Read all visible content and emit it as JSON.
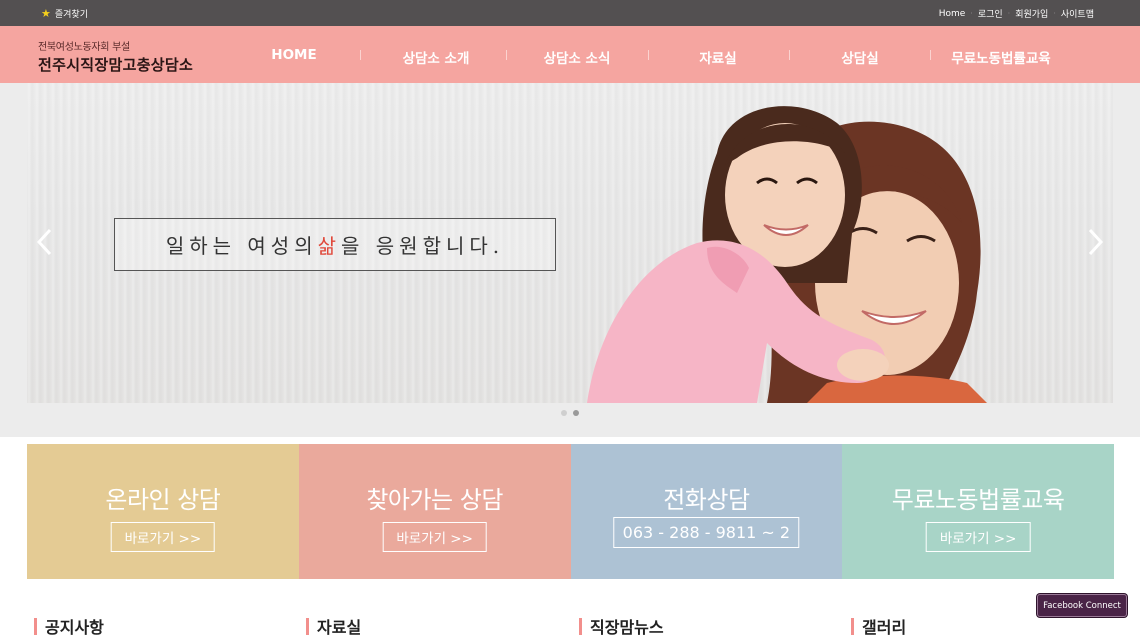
{
  "topbar": {
    "favorite_label": "즐겨찾기",
    "links": [
      "Home",
      "로그인",
      "회원가입",
      "사이트맵"
    ]
  },
  "header": {
    "logo_sub": "전북여성노동자회 부설",
    "logo_main": "전주시직장맘고충상담소",
    "nav": [
      "HOME",
      "상담소 소개",
      "상담소 소식",
      "자료실",
      "상담실",
      "무료노동법률교육"
    ]
  },
  "hero": {
    "slogan_before": "일하는 여성의 ",
    "slogan_accent": "삶",
    "slogan_after": "을 응원합니다.",
    "slide_count": 2,
    "active_slide": 2
  },
  "tiles": [
    {
      "title": "온라인 상담",
      "button": "바로가기 >>",
      "color": "#e4cb94"
    },
    {
      "title": "찾아가는 상담",
      "button": "바로가기 >>",
      "color": "#eaa99c"
    },
    {
      "title": "전화상담",
      "button": "063 - 288 - 9811 ~ 2",
      "color": "#adc2d4"
    },
    {
      "title": "무료노동법률교육",
      "button": "바로가기 >>",
      "color": "#a8d4c7"
    }
  ],
  "sections": [
    "공지사항",
    "자료실",
    "직장맘뉴스",
    "갤러리"
  ],
  "facebook_button": "Facebook Connect",
  "colors": {
    "topbar": "#535051",
    "header": "#f5a5a0",
    "accent": "#e0483a",
    "section_bar": "#f28f8c"
  }
}
